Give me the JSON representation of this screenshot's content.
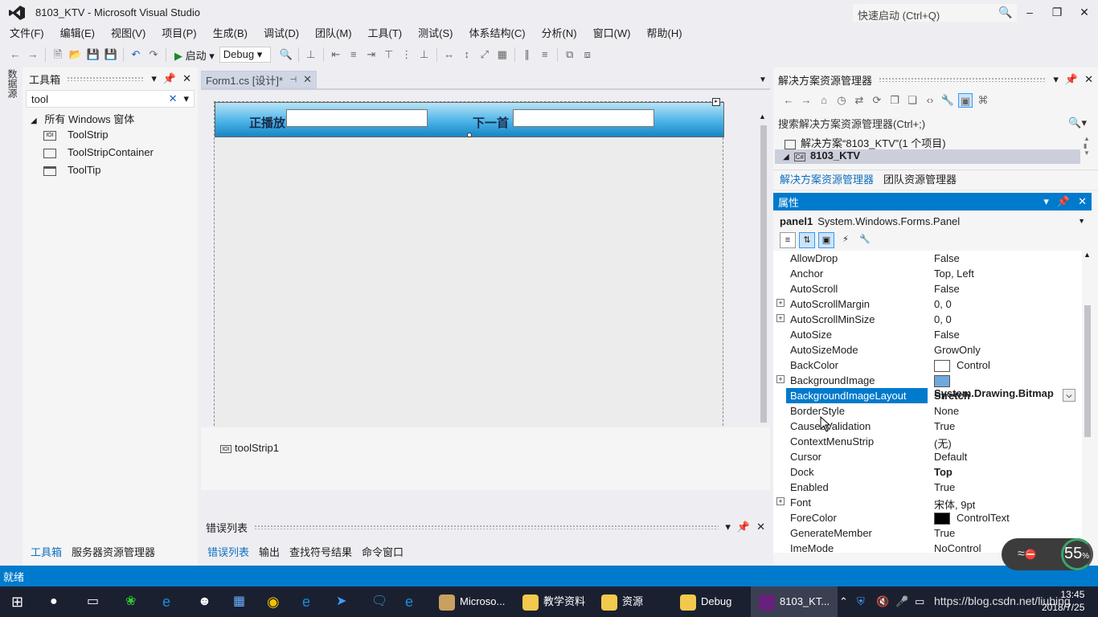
{
  "window": {
    "title": "8103_KTV - Microsoft Visual Studio",
    "quick_launch": "快速启动 (Ctrl+Q)"
  },
  "menu": [
    "文件(F)",
    "编辑(E)",
    "视图(V)",
    "项目(P)",
    "生成(B)",
    "调试(D)",
    "团队(M)",
    "工具(T)",
    "测试(S)",
    "体系结构(C)",
    "分析(N)",
    "窗口(W)",
    "帮助(H)"
  ],
  "toolbar": {
    "start_label": "启动",
    "config": "Debug"
  },
  "side_tab": "数据源",
  "toolbox": {
    "title": "工具箱",
    "search": "tool",
    "group": "所有 Windows 窗体",
    "items": [
      "ToolStrip",
      "ToolStripContainer",
      "ToolTip"
    ],
    "tabs": [
      "工具箱",
      "服务器资源管理器"
    ]
  },
  "editor": {
    "tab": "Form1.cs [设计]*",
    "panel_label_1": "正播放",
    "panel_label_2": "下一首",
    "tray_item": "toolStrip1"
  },
  "error_list": {
    "title": "错误列表",
    "tabs": [
      "错误列表",
      "输出",
      "查找符号结果",
      "命令窗口"
    ]
  },
  "solution": {
    "title": "解决方案资源管理器",
    "search_placeholder": "搜索解决方案资源管理器(Ctrl+;)",
    "solution_node": "解决方案“8103_KTV”(1 个项目)",
    "project_node": "8103_KTV",
    "tabs": [
      "解决方案资源管理器",
      "团队资源管理器"
    ]
  },
  "properties": {
    "title": "属性",
    "object_name": "panel1",
    "object_type": "System.Windows.Forms.Panel",
    "selected": "BackgroundImageLayout",
    "rows": [
      {
        "name": "AllowDrop",
        "value": "False"
      },
      {
        "name": "Anchor",
        "value": "Top, Left"
      },
      {
        "name": "AutoScroll",
        "value": "False"
      },
      {
        "name": "AutoScrollMargin",
        "value": "0, 0",
        "expand": true
      },
      {
        "name": "AutoScrollMinSize",
        "value": "0, 0",
        "expand": true
      },
      {
        "name": "AutoSize",
        "value": "False"
      },
      {
        "name": "AutoSizeMode",
        "value": "GrowOnly"
      },
      {
        "name": "BackColor",
        "value": "Control",
        "swatch": "#ffffff"
      },
      {
        "name": "BackgroundImage",
        "value": "System.Drawing.Bitmap",
        "expand": true,
        "bold": true,
        "swatch": "#6fa8dc"
      },
      {
        "name": "BackgroundImageLayout",
        "value": "Stretch",
        "bold": true,
        "selected": true
      },
      {
        "name": "BorderStyle",
        "value": "None"
      },
      {
        "name": "CausesValidation",
        "value": "True"
      },
      {
        "name": "ContextMenuStrip",
        "value": "(无)"
      },
      {
        "name": "Cursor",
        "value": "Default"
      },
      {
        "name": "Dock",
        "value": "Top",
        "bold": true
      },
      {
        "name": "Enabled",
        "value": "True"
      },
      {
        "name": "Font",
        "value": "宋体, 9pt",
        "expand": true
      },
      {
        "name": "ForeColor",
        "value": "ControlText",
        "swatch": "#000000"
      },
      {
        "name": "GenerateMember",
        "value": "True"
      },
      {
        "name": "ImeMode",
        "value": "NoControl"
      }
    ]
  },
  "status": {
    "text": "就绪"
  },
  "network": {
    "percent": "55",
    "suffix": "%"
  },
  "taskbar": {
    "apps": [
      "Microso...",
      "教学资料",
      "资源",
      "Debug",
      "8103_KT..."
    ],
    "time": "13:45",
    "date": "2018/7/25",
    "watermark": "https://blog.csdn.net/liubing"
  }
}
